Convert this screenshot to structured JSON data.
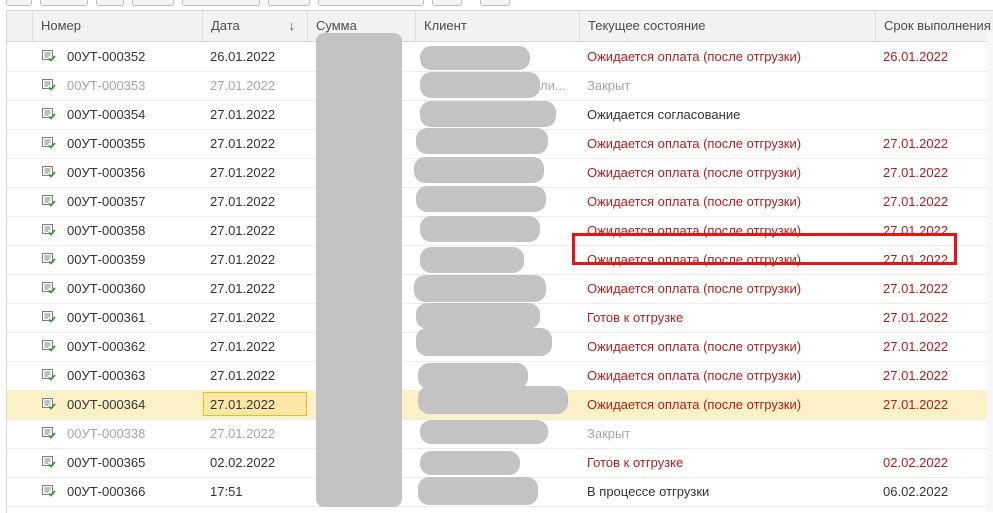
{
  "colors": {
    "state_red": "#b01f1f",
    "closed_gray": "#a5a5a5",
    "selected_row": "#fbf0c6",
    "highlight_box": "#ee1111",
    "header_bg": "#f2f2f2"
  },
  "table": {
    "headers": {
      "number": "Номер",
      "date": "Дата",
      "sort_arrow": "↓",
      "sum": "Сумма",
      "client": "Клиент",
      "state": "Текущее состояние",
      "deadline": "Срок выполнения"
    },
    "client_fragment": "ли...",
    "rows": [
      {
        "number": "00УТ-000352",
        "date": "26.01.2022",
        "state": "Ожидается оплата (после отгрузки)",
        "deadline": "26.01.2022",
        "tone": "red"
      },
      {
        "number": "00УТ-000353",
        "date": "27.01.2022",
        "state": "Закрыт",
        "deadline": "",
        "tone": "gray"
      },
      {
        "number": "00УТ-000354",
        "date": "27.01.2022",
        "state": "Ожидается согласование",
        "deadline": "",
        "tone": "dark"
      },
      {
        "number": "00УТ-000355",
        "date": "27.01.2022",
        "state": "Ожидается оплата (после отгрузки)",
        "deadline": "27.01.2022",
        "tone": "red"
      },
      {
        "number": "00УТ-000356",
        "date": "27.01.2022",
        "state": "Ожидается оплата (после отгрузки)",
        "deadline": "27.01.2022",
        "tone": "red"
      },
      {
        "number": "00УТ-000357",
        "date": "27.01.2022",
        "state": "Ожидается оплата (после отгрузки)",
        "deadline": "27.01.2022",
        "tone": "red"
      },
      {
        "number": "00УТ-000358",
        "date": "27.01.2022",
        "state": "Ожидается оплата (после отгрузки)",
        "deadline": "27.01.2022",
        "tone": "red"
      },
      {
        "number": "00УТ-000359",
        "date": "27.01.2022",
        "state": "Ожидается оплата (после отгрузки)",
        "deadline": "27.01.2022",
        "tone": "red"
      },
      {
        "number": "00УТ-000360",
        "date": "27.01.2022",
        "state": "Ожидается оплата (после отгрузки)",
        "deadline": "27.01.2022",
        "tone": "red"
      },
      {
        "number": "00УТ-000361",
        "date": "27.01.2022",
        "state": "Готов к отгрузке",
        "deadline": "27.01.2022",
        "tone": "red"
      },
      {
        "number": "00УТ-000362",
        "date": "27.01.2022",
        "state": "Ожидается оплата (после отгрузки)",
        "deadline": "27.01.2022",
        "tone": "red"
      },
      {
        "number": "00УТ-000363",
        "date": "27.01.2022",
        "state": "Ожидается оплата (после отгрузки)",
        "deadline": "27.01.2022",
        "tone": "red"
      },
      {
        "number": "00УТ-000364",
        "date": "27.01.2022",
        "state": "Ожидается оплата (после отгрузки)",
        "deadline": "27.01.2022",
        "tone": "red",
        "selected": true
      },
      {
        "number": "00УТ-000338",
        "date": "27.01.2022",
        "state": "Закрыт",
        "deadline": "",
        "tone": "gray"
      },
      {
        "number": "00УТ-000365",
        "date": "02.02.2022",
        "state": "Готов к отгрузке",
        "deadline": "02.02.2022",
        "tone": "red"
      },
      {
        "number": "00УТ-000366",
        "date": "17:51",
        "state": "В процессе отгрузки",
        "deadline": "06.02.2022",
        "tone": "dark"
      }
    ]
  }
}
